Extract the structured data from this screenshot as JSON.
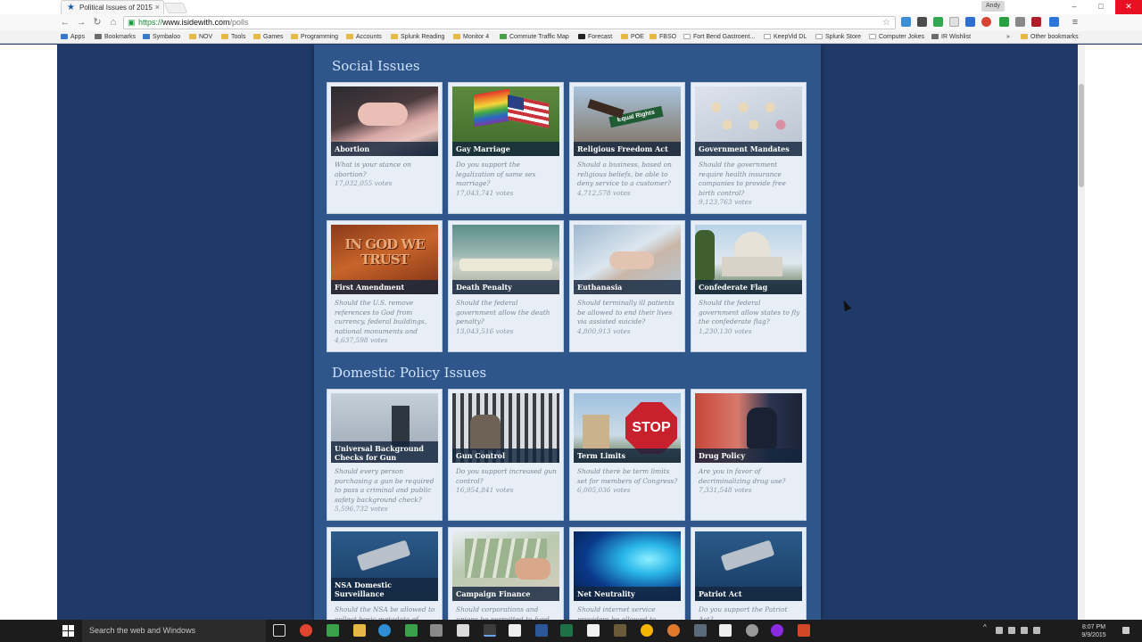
{
  "browser": {
    "tab_title": "Political Issues of 2015",
    "tab_close": "×",
    "user_name": "Andy",
    "url_scheme": "https://",
    "url_host": "www.isidewith.com",
    "url_path": "/polls",
    "bookmarks": [
      "Apps",
      "Bookmarks",
      "Symbaloo",
      "NOV",
      "Tools",
      "Games",
      "Programming",
      "Accounts",
      "Splunk Reading",
      "Monitor 4",
      "Commute Traffic Map",
      "Forecast",
      "POE",
      "FBSO",
      "Fort Bend Gastroent...",
      "KeepVid DL",
      "Splunk Store",
      "Computer Jokes",
      "IR Wishlist"
    ],
    "bookmarks_overflow": "»",
    "other_bookmarks": "Other bookmarks"
  },
  "page": {
    "social_title": "Social Issues",
    "domestic_title": "Domestic Policy Issues",
    "social_cards": [
      {
        "title": "Abortion",
        "question": "What is your stance on abortion?",
        "votes": "17,032,055 votes"
      },
      {
        "title": "Gay Marriage",
        "question": "Do you support the legalization of same sex marriage?",
        "votes": "17,043,741 votes"
      },
      {
        "title": "Religious Freedom Act",
        "question": "Should a business, based on religious beliefs, be able to deny service to a customer?",
        "votes": "4,712,578 votes"
      },
      {
        "title": "Government Mandates",
        "question": "Should the government require health insurance companies to provide free birth control?",
        "votes": "9,123,763 votes"
      },
      {
        "title": "First Amendment",
        "question": "Should the U.S. remove references to God from currency, federal buildings, national monuments and",
        "votes": "4,637,598 votes"
      },
      {
        "title": "Death Penalty",
        "question": "Should the federal government allow the death penalty?",
        "votes": "13,043,516 votes"
      },
      {
        "title": "Euthanasia",
        "question": "Should terminally ill patients be allowed to end their lives via assisted suicide?",
        "votes": "4,800,913 votes"
      },
      {
        "title": "Confederate Flag",
        "question": "Should the federal government allow states to fly the confederate flag?",
        "votes": "1,230,130 votes"
      }
    ],
    "domestic_cards": [
      {
        "title": "Universal Background Checks for Gun Purchases",
        "question": "Should every person purchasing a gun be required to pass a criminal and public safety background check?",
        "votes": "5,596,732 votes"
      },
      {
        "title": "Gun Control",
        "question": "Do you support increased gun control?",
        "votes": "16,954,841 votes"
      },
      {
        "title": "Term Limits",
        "question": "Should there be term limits set for members of Congress?",
        "votes": "6,005,036 votes"
      },
      {
        "title": "Drug Policy",
        "question": "Are you in favor of decriminalizing drug use?",
        "votes": "7,331,548 votes"
      },
      {
        "title": "NSA Domestic Surveillance",
        "question": "Should the NSA be allowed to collect basic metadata of",
        "votes": ""
      },
      {
        "title": "Campaign Finance",
        "question": "Should corporations and unions be permitted to fund",
        "votes": ""
      },
      {
        "title": "Net Neutrality",
        "question": "Should internet service providers be allowed to",
        "votes": ""
      },
      {
        "title": "Patriot Act",
        "question": "Do you support the Patriot Act?",
        "votes": ""
      }
    ],
    "stop_sign_text": "STOP",
    "trust_text": "IN GOD WE TRUST",
    "street_sign_text": "Equal Rights"
  },
  "taskbar": {
    "search_placeholder": "Search the web and Windows",
    "time": "8:07 PM",
    "date": "9/9/2015"
  }
}
